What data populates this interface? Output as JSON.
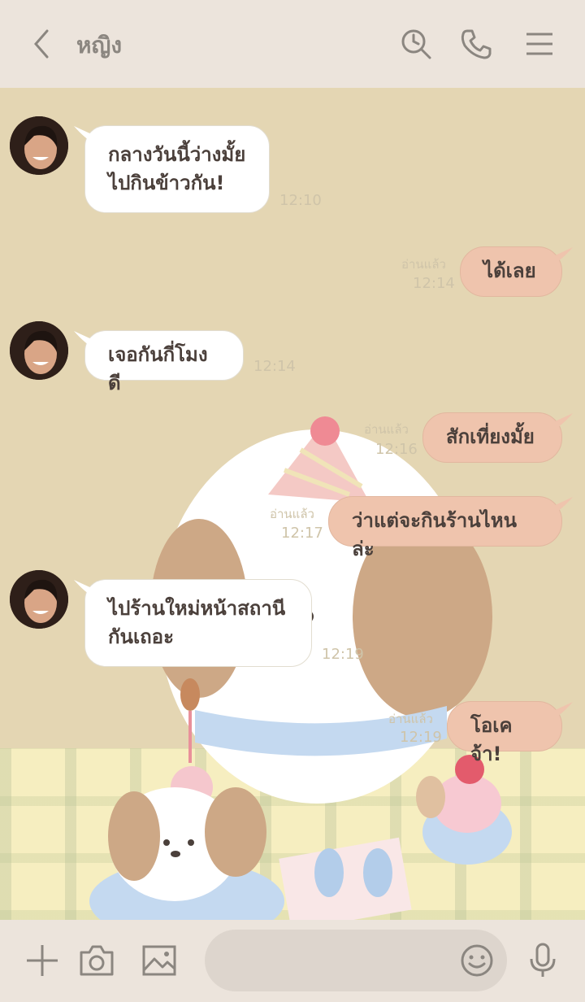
{
  "header": {
    "title": "หญิง",
    "icons": [
      "back-chevron-icon",
      "search-history-icon",
      "phone-icon",
      "menu-icon"
    ]
  },
  "messages": [
    {
      "side": "in",
      "lines": [
        "กลางวันนี้ว่างมั้ย",
        "ไปกินข้าวกัน!"
      ],
      "time": "12:10"
    },
    {
      "side": "out",
      "text": "ได้เลย",
      "read": "อ่านแล้ว",
      "time": "12:14"
    },
    {
      "side": "in",
      "lines": [
        "เจอกันกี่โมงดี"
      ],
      "time": "12:14"
    },
    {
      "side": "out",
      "text": "สักเที่ยงมั้ย",
      "read": "อ่านแล้ว",
      "time": "12:16"
    },
    {
      "side": "out",
      "text": "ว่าแต่จะกินร้านไหนล่ะ",
      "read": "อ่านแล้ว",
      "time": "12:17"
    },
    {
      "side": "in",
      "lines": [
        "ไปร้านใหม่หน้าสถานี",
        "กันเถอะ"
      ],
      "time": "12:19"
    },
    {
      "side": "out",
      "text": "โอเคจ้า!",
      "read": "อ่านแล้ว",
      "time": "12:19"
    }
  ],
  "footer": {
    "icons": [
      "plus-icon",
      "camera-icon",
      "image-icon",
      "emoji-icon",
      "microphone-icon"
    ],
    "input_value": ""
  },
  "colors": {
    "header_bg": "#ece4dc",
    "chat_bg": "#e4d6b3",
    "outgoing_bubble": "#efc4ad",
    "incoming_bubble": "#ffffff",
    "icon": "#8b8680"
  }
}
